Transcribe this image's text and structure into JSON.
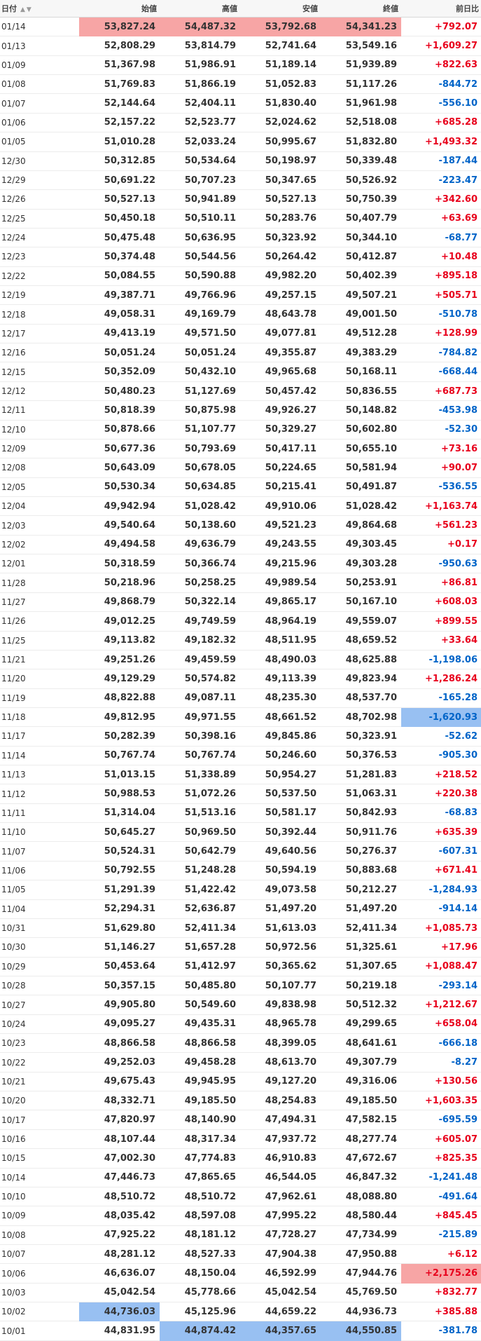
{
  "table": {
    "headers": {
      "date": "日付",
      "open": "始値",
      "high": "高値",
      "low": "安値",
      "close": "終値",
      "change": "前日比"
    },
    "sort_icon": "sort-up-down-icon",
    "highlight_colors": {
      "max": "#f7a5a5",
      "min": "#98c0f2",
      "up": "#e8001c",
      "down": "#0064c8"
    },
    "rows": [
      {
        "date": "01/14",
        "open": "53,827.24",
        "high": "54,487.32",
        "low": "53,792.68",
        "close": "54,341.23",
        "change": "+792.07"
      },
      {
        "date": "01/13",
        "open": "52,808.29",
        "high": "53,814.79",
        "low": "52,741.64",
        "close": "53,549.16",
        "change": "+1,609.27"
      },
      {
        "date": "01/09",
        "open": "51,367.98",
        "high": "51,986.91",
        "low": "51,189.14",
        "close": "51,939.89",
        "change": "+822.63"
      },
      {
        "date": "01/08",
        "open": "51,769.83",
        "high": "51,866.19",
        "low": "51,052.83",
        "close": "51,117.26",
        "change": "-844.72"
      },
      {
        "date": "01/07",
        "open": "52,144.64",
        "high": "52,404.11",
        "low": "51,830.40",
        "close": "51,961.98",
        "change": "-556.10"
      },
      {
        "date": "01/06",
        "open": "52,157.22",
        "high": "52,523.77",
        "low": "52,024.62",
        "close": "52,518.08",
        "change": "+685.28"
      },
      {
        "date": "01/05",
        "open": "51,010.28",
        "high": "52,033.24",
        "low": "50,995.67",
        "close": "51,832.80",
        "change": "+1,493.32"
      },
      {
        "date": "12/30",
        "open": "50,312.85",
        "high": "50,534.64",
        "low": "50,198.97",
        "close": "50,339.48",
        "change": "-187.44"
      },
      {
        "date": "12/29",
        "open": "50,691.22",
        "high": "50,707.23",
        "low": "50,347.65",
        "close": "50,526.92",
        "change": "-223.47"
      },
      {
        "date": "12/26",
        "open": "50,527.13",
        "high": "50,941.89",
        "low": "50,527.13",
        "close": "50,750.39",
        "change": "+342.60"
      },
      {
        "date": "12/25",
        "open": "50,450.18",
        "high": "50,510.11",
        "low": "50,283.76",
        "close": "50,407.79",
        "change": "+63.69"
      },
      {
        "date": "12/24",
        "open": "50,475.48",
        "high": "50,636.95",
        "low": "50,323.92",
        "close": "50,344.10",
        "change": "-68.77"
      },
      {
        "date": "12/23",
        "open": "50,374.48",
        "high": "50,544.56",
        "low": "50,264.42",
        "close": "50,412.87",
        "change": "+10.48"
      },
      {
        "date": "12/22",
        "open": "50,084.55",
        "high": "50,590.88",
        "low": "49,982.20",
        "close": "50,402.39",
        "change": "+895.18"
      },
      {
        "date": "12/19",
        "open": "49,387.71",
        "high": "49,766.96",
        "low": "49,257.15",
        "close": "49,507.21",
        "change": "+505.71"
      },
      {
        "date": "12/18",
        "open": "49,058.31",
        "high": "49,169.79",
        "low": "48,643.78",
        "close": "49,001.50",
        "change": "-510.78"
      },
      {
        "date": "12/17",
        "open": "49,413.19",
        "high": "49,571.50",
        "low": "49,077.81",
        "close": "49,512.28",
        "change": "+128.99"
      },
      {
        "date": "12/16",
        "open": "50,051.24",
        "high": "50,051.24",
        "low": "49,355.87",
        "close": "49,383.29",
        "change": "-784.82"
      },
      {
        "date": "12/15",
        "open": "50,352.09",
        "high": "50,432.10",
        "low": "49,965.68",
        "close": "50,168.11",
        "change": "-668.44"
      },
      {
        "date": "12/12",
        "open": "50,480.23",
        "high": "51,127.69",
        "low": "50,457.42",
        "close": "50,836.55",
        "change": "+687.73"
      },
      {
        "date": "12/11",
        "open": "50,818.39",
        "high": "50,875.98",
        "low": "49,926.27",
        "close": "50,148.82",
        "change": "-453.98"
      },
      {
        "date": "12/10",
        "open": "50,878.66",
        "high": "51,107.77",
        "low": "50,329.27",
        "close": "50,602.80",
        "change": "-52.30"
      },
      {
        "date": "12/09",
        "open": "50,677.36",
        "high": "50,793.69",
        "low": "50,417.11",
        "close": "50,655.10",
        "change": "+73.16"
      },
      {
        "date": "12/08",
        "open": "50,643.09",
        "high": "50,678.05",
        "low": "50,224.65",
        "close": "50,581.94",
        "change": "+90.07"
      },
      {
        "date": "12/05",
        "open": "50,530.34",
        "high": "50,634.85",
        "low": "50,215.41",
        "close": "50,491.87",
        "change": "-536.55"
      },
      {
        "date": "12/04",
        "open": "49,942.94",
        "high": "51,028.42",
        "low": "49,910.06",
        "close": "51,028.42",
        "change": "+1,163.74"
      },
      {
        "date": "12/03",
        "open": "49,540.64",
        "high": "50,138.60",
        "low": "49,521.23",
        "close": "49,864.68",
        "change": "+561.23"
      },
      {
        "date": "12/02",
        "open": "49,494.58",
        "high": "49,636.79",
        "low": "49,243.55",
        "close": "49,303.45",
        "change": "+0.17"
      },
      {
        "date": "12/01",
        "open": "50,318.59",
        "high": "50,366.74",
        "low": "49,215.96",
        "close": "49,303.28",
        "change": "-950.63"
      },
      {
        "date": "11/28",
        "open": "50,218.96",
        "high": "50,258.25",
        "low": "49,989.54",
        "close": "50,253.91",
        "change": "+86.81"
      },
      {
        "date": "11/27",
        "open": "49,868.79",
        "high": "50,322.14",
        "low": "49,865.17",
        "close": "50,167.10",
        "change": "+608.03"
      },
      {
        "date": "11/26",
        "open": "49,012.25",
        "high": "49,749.59",
        "low": "48,964.19",
        "close": "49,559.07",
        "change": "+899.55"
      },
      {
        "date": "11/25",
        "open": "49,113.82",
        "high": "49,182.32",
        "low": "48,511.95",
        "close": "48,659.52",
        "change": "+33.64"
      },
      {
        "date": "11/21",
        "open": "49,251.26",
        "high": "49,459.59",
        "low": "48,490.03",
        "close": "48,625.88",
        "change": "-1,198.06"
      },
      {
        "date": "11/20",
        "open": "49,129.29",
        "high": "50,574.82",
        "low": "49,113.39",
        "close": "49,823.94",
        "change": "+1,286.24"
      },
      {
        "date": "11/19",
        "open": "48,822.88",
        "high": "49,087.11",
        "low": "48,235.30",
        "close": "48,537.70",
        "change": "-165.28"
      },
      {
        "date": "11/18",
        "open": "49,812.95",
        "high": "49,971.55",
        "low": "48,661.52",
        "close": "48,702.98",
        "change": "-1,620.93"
      },
      {
        "date": "11/17",
        "open": "50,282.39",
        "high": "50,398.16",
        "low": "49,845.86",
        "close": "50,323.91",
        "change": "-52.62"
      },
      {
        "date": "11/14",
        "open": "50,767.74",
        "high": "50,767.74",
        "low": "50,246.60",
        "close": "50,376.53",
        "change": "-905.30"
      },
      {
        "date": "11/13",
        "open": "51,013.15",
        "high": "51,338.89",
        "low": "50,954.27",
        "close": "51,281.83",
        "change": "+218.52"
      },
      {
        "date": "11/12",
        "open": "50,988.53",
        "high": "51,072.26",
        "low": "50,537.50",
        "close": "51,063.31",
        "change": "+220.38"
      },
      {
        "date": "11/11",
        "open": "51,314.04",
        "high": "51,513.16",
        "low": "50,581.17",
        "close": "50,842.93",
        "change": "-68.83"
      },
      {
        "date": "11/10",
        "open": "50,645.27",
        "high": "50,969.50",
        "low": "50,392.44",
        "close": "50,911.76",
        "change": "+635.39"
      },
      {
        "date": "11/07",
        "open": "50,524.31",
        "high": "50,642.79",
        "low": "49,640.56",
        "close": "50,276.37",
        "change": "-607.31"
      },
      {
        "date": "11/06",
        "open": "50,792.55",
        "high": "51,248.28",
        "low": "50,594.19",
        "close": "50,883.68",
        "change": "+671.41"
      },
      {
        "date": "11/05",
        "open": "51,291.39",
        "high": "51,422.42",
        "low": "49,073.58",
        "close": "50,212.27",
        "change": "-1,284.93"
      },
      {
        "date": "11/04",
        "open": "52,294.31",
        "high": "52,636.87",
        "low": "51,497.20",
        "close": "51,497.20",
        "change": "-914.14"
      },
      {
        "date": "10/31",
        "open": "51,629.80",
        "high": "52,411.34",
        "low": "51,613.03",
        "close": "52,411.34",
        "change": "+1,085.73"
      },
      {
        "date": "10/30",
        "open": "51,146.27",
        "high": "51,657.28",
        "low": "50,972.56",
        "close": "51,325.61",
        "change": "+17.96"
      },
      {
        "date": "10/29",
        "open": "50,453.64",
        "high": "51,412.97",
        "low": "50,365.62",
        "close": "51,307.65",
        "change": "+1,088.47"
      },
      {
        "date": "10/28",
        "open": "50,357.15",
        "high": "50,485.80",
        "low": "50,107.77",
        "close": "50,219.18",
        "change": "-293.14"
      },
      {
        "date": "10/27",
        "open": "49,905.80",
        "high": "50,549.60",
        "low": "49,838.98",
        "close": "50,512.32",
        "change": "+1,212.67"
      },
      {
        "date": "10/24",
        "open": "49,095.27",
        "high": "49,435.31",
        "low": "48,965.78",
        "close": "49,299.65",
        "change": "+658.04"
      },
      {
        "date": "10/23",
        "open": "48,866.58",
        "high": "48,866.58",
        "low": "48,399.05",
        "close": "48,641.61",
        "change": "-666.18"
      },
      {
        "date": "10/22",
        "open": "49,252.03",
        "high": "49,458.28",
        "low": "48,613.70",
        "close": "49,307.79",
        "change": "-8.27"
      },
      {
        "date": "10/21",
        "open": "49,675.43",
        "high": "49,945.95",
        "low": "49,127.20",
        "close": "49,316.06",
        "change": "+130.56"
      },
      {
        "date": "10/20",
        "open": "48,332.71",
        "high": "49,185.50",
        "low": "48,254.83",
        "close": "49,185.50",
        "change": "+1,603.35"
      },
      {
        "date": "10/17",
        "open": "47,820.97",
        "high": "48,140.90",
        "low": "47,494.31",
        "close": "47,582.15",
        "change": "-695.59"
      },
      {
        "date": "10/16",
        "open": "48,107.44",
        "high": "48,317.34",
        "low": "47,937.72",
        "close": "48,277.74",
        "change": "+605.07"
      },
      {
        "date": "10/15",
        "open": "47,002.30",
        "high": "47,774.83",
        "low": "46,910.83",
        "close": "47,672.67",
        "change": "+825.35"
      },
      {
        "date": "10/14",
        "open": "47,446.73",
        "high": "47,865.65",
        "low": "46,544.05",
        "close": "46,847.32",
        "change": "-1,241.48"
      },
      {
        "date": "10/10",
        "open": "48,510.72",
        "high": "48,510.72",
        "low": "47,962.61",
        "close": "48,088.80",
        "change": "-491.64"
      },
      {
        "date": "10/09",
        "open": "48,035.42",
        "high": "48,597.08",
        "low": "47,995.22",
        "close": "48,580.44",
        "change": "+845.45"
      },
      {
        "date": "10/08",
        "open": "47,925.22",
        "high": "48,181.12",
        "low": "47,728.27",
        "close": "47,734.99",
        "change": "-215.89"
      },
      {
        "date": "10/07",
        "open": "48,281.12",
        "high": "48,527.33",
        "low": "47,904.38",
        "close": "47,950.88",
        "change": "+6.12"
      },
      {
        "date": "10/06",
        "open": "46,636.07",
        "high": "48,150.04",
        "low": "46,592.99",
        "close": "47,944.76",
        "change": "+2,175.26"
      },
      {
        "date": "10/03",
        "open": "45,042.54",
        "high": "45,778.66",
        "low": "45,042.54",
        "close": "45,769.50",
        "change": "+832.77"
      },
      {
        "date": "10/02",
        "open": "44,736.03",
        "high": "45,125.96",
        "low": "44,659.22",
        "close": "44,936.73",
        "change": "+385.88"
      },
      {
        "date": "10/01",
        "open": "44,831.95",
        "high": "44,874.42",
        "low": "44,357.65",
        "close": "44,550.85",
        "change": "-381.78"
      }
    ]
  }
}
